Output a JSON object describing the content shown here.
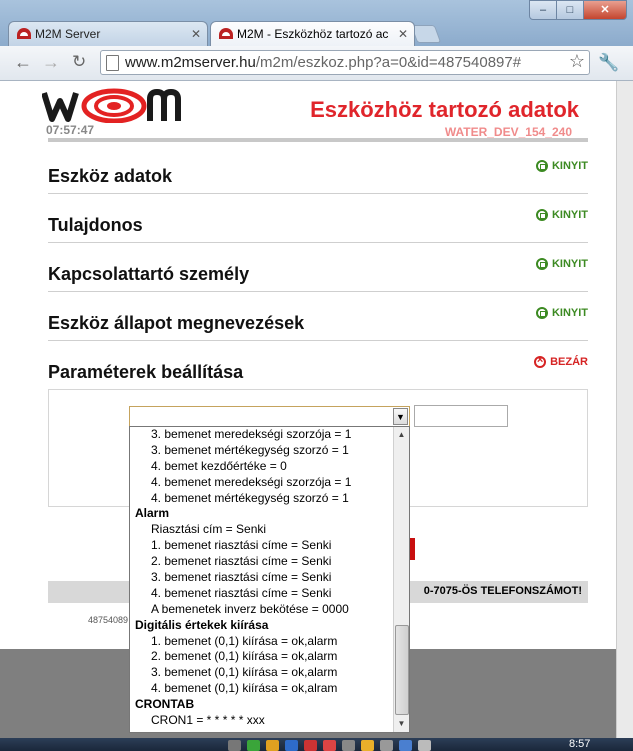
{
  "browser": {
    "tabs": [
      {
        "label": "M2M Server",
        "active": false
      },
      {
        "label": "M2M - Eszközhöz tartozó ac",
        "active": true
      }
    ],
    "url_host": "www.m2mserver.hu",
    "url_path": "/m2m/eszkoz.php?a=0&id=487540897#",
    "window_buttons": {
      "minimize": "–",
      "maximize": "□",
      "close": "✕"
    }
  },
  "header": {
    "clock": "07:57:47",
    "title": "Eszközhöz tartozó adatok",
    "device_id": "WATER_DEV_154_240"
  },
  "sections": [
    {
      "title": "Eszköz adatok",
      "action": "KINYIT"
    },
    {
      "title": "Tulajdonos",
      "action": "KINYIT"
    },
    {
      "title": "Kapcsolattartó személy",
      "action": "KINYIT"
    },
    {
      "title": "Eszköz állapot megnevezések",
      "action": "KINYIT"
    },
    {
      "title": "Paraméterek beállítása",
      "action": "BEZÁR"
    }
  ],
  "phone_notice": "0-7075-ÖS TELEFONSZÁMOT!",
  "footer_id": "48754089",
  "dropdown": {
    "items": [
      {
        "type": "option",
        "label": "3. bemenet meredekségi szorzója = 1"
      },
      {
        "type": "option",
        "label": "3. bemenet mértékegység szorzó = 1"
      },
      {
        "type": "option",
        "label": "4. bemet kezdőértéke = 0"
      },
      {
        "type": "option",
        "label": "4. bemenet meredekségi szorzója = 1"
      },
      {
        "type": "option",
        "label": "4. bemenet mértékegység szorzó = 1"
      },
      {
        "type": "group",
        "label": "Alarm"
      },
      {
        "type": "option",
        "label": "Riasztási cím = Senki"
      },
      {
        "type": "option",
        "label": "1. bemenet riasztási címe = Senki"
      },
      {
        "type": "option",
        "label": "2. bemenet riasztási címe = Senki"
      },
      {
        "type": "option",
        "label": "3. bemenet riasztási címe = Senki"
      },
      {
        "type": "option",
        "label": "4. bemenet riasztási címe = Senki"
      },
      {
        "type": "option",
        "label": "A bemenetek inverz bekötése = 0000"
      },
      {
        "type": "group",
        "label": "Digitális értekek kiírása"
      },
      {
        "type": "option",
        "label": "1. bemenet (0,1) kiírása = ok,alarm"
      },
      {
        "type": "option",
        "label": "2. bemenet (0,1) kiírása = ok,alarm"
      },
      {
        "type": "option",
        "label": "3. bemenet (0,1) kiírása = ok,alarm"
      },
      {
        "type": "option",
        "label": "4. bemenet (0,1) kiírása = ok,alram"
      },
      {
        "type": "group",
        "label": "CRONTAB"
      },
      {
        "type": "option",
        "label": "CRON1 = * * * * * xxx"
      }
    ]
  },
  "taskbar": {
    "clock": "8:57"
  },
  "colors": {
    "title_red": "#e0252b",
    "device_id_pink": "#f08b8b",
    "open_green": "#3c8a22",
    "close_red": "#d62424"
  },
  "icons": {
    "logo": "m2m-logo",
    "open_toggle": "open-circle-icon",
    "close_toggle": "close-circle-icon"
  }
}
